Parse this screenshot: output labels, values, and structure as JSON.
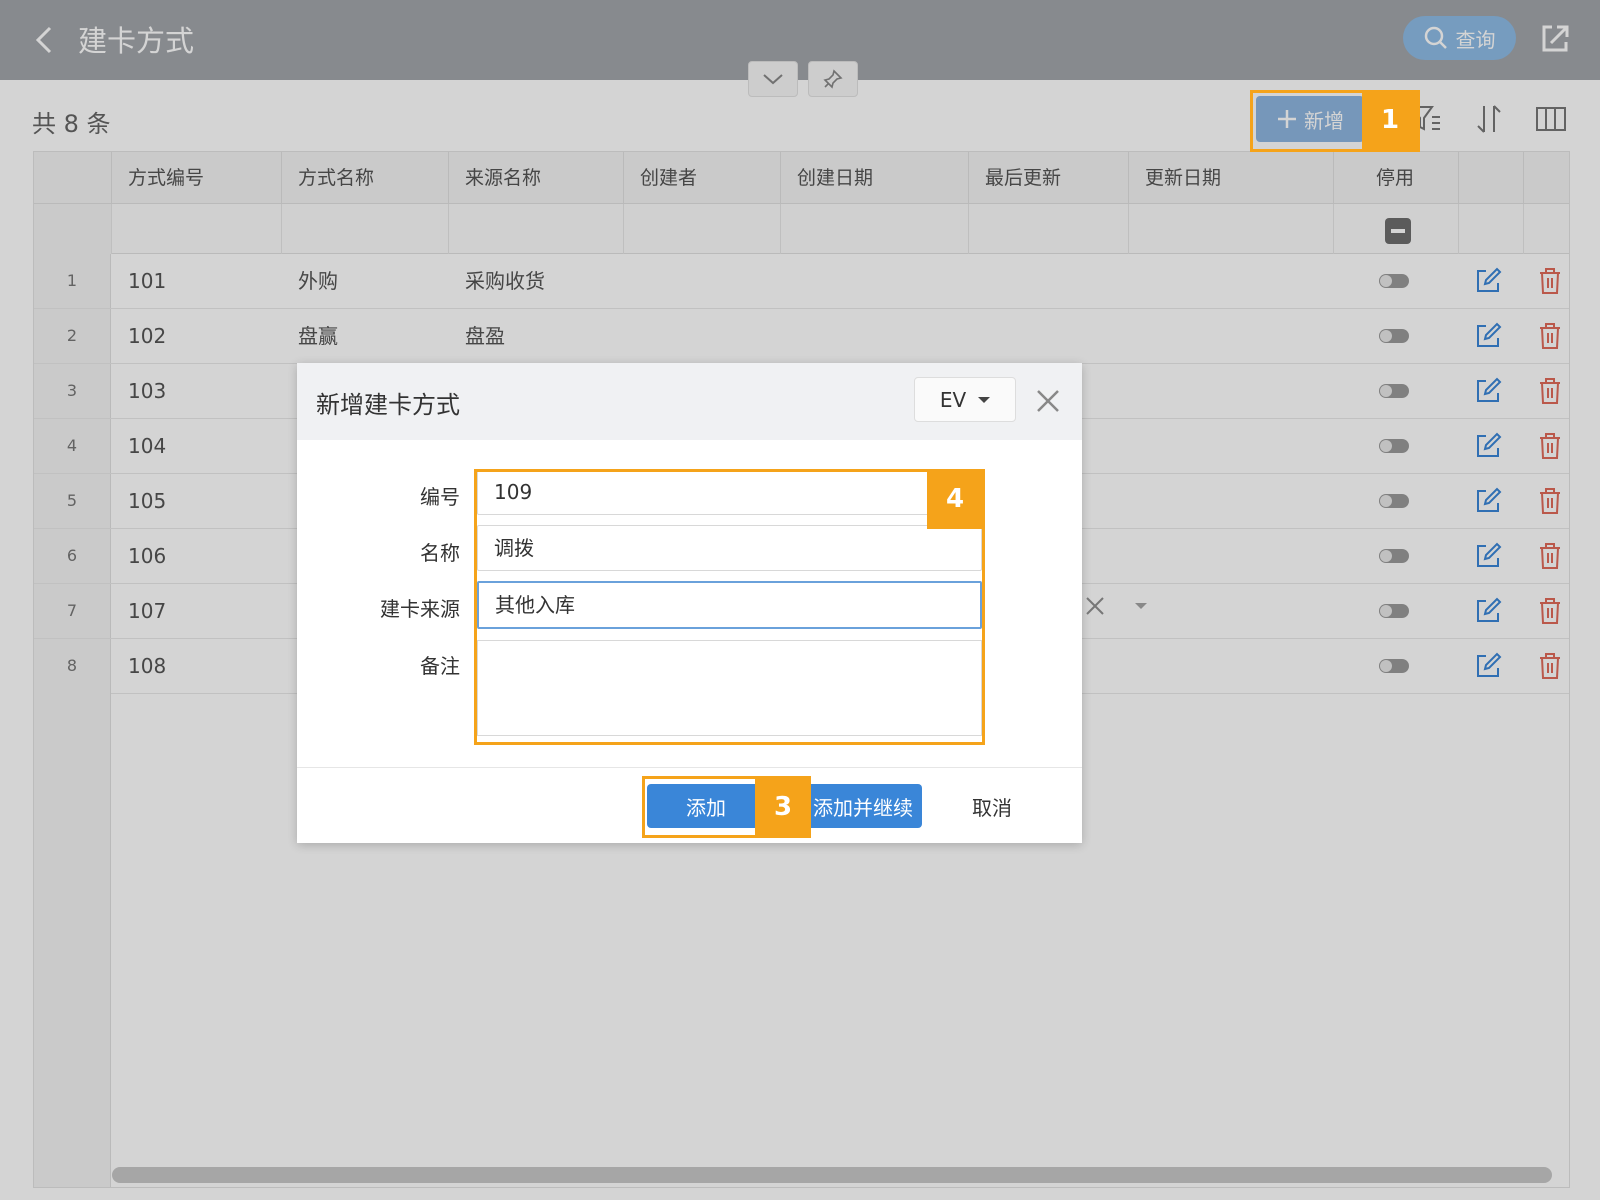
{
  "header": {
    "title": "建卡方式",
    "query_label": "查询"
  },
  "toolbar": {
    "count_text": "共 8 条",
    "add_label": "新增"
  },
  "table": {
    "columns": [
      "方式编号",
      "方式名称",
      "来源名称",
      "创建者",
      "创建日期",
      "最后更新",
      "更新日期",
      "停用"
    ],
    "rows": [
      {
        "index": "1",
        "code": "101",
        "name": "外购",
        "source": "采购收货"
      },
      {
        "index": "2",
        "code": "102",
        "name": "盘赢",
        "source": "盘盈"
      },
      {
        "index": "3",
        "code": "103",
        "name": "",
        "source": ""
      },
      {
        "index": "4",
        "code": "104",
        "name": "",
        "source": ""
      },
      {
        "index": "5",
        "code": "105",
        "name": "",
        "source": ""
      },
      {
        "index": "6",
        "code": "106",
        "name": "",
        "source": ""
      },
      {
        "index": "7",
        "code": "107",
        "name": "",
        "source": ""
      },
      {
        "index": "8",
        "code": "108",
        "name": "",
        "source": ""
      }
    ]
  },
  "modal": {
    "title": "新增建卡方式",
    "lang": "EV",
    "fields": {
      "code_label": "编号",
      "code_value": "109",
      "name_label": "名称",
      "name_value": "调拨",
      "source_label": "建卡来源",
      "source_value": "其他入库",
      "note_label": "备注",
      "note_value": ""
    },
    "buttons": {
      "add": "添加",
      "add_continue": "添加并继续",
      "cancel": "取消"
    }
  },
  "annotations": {
    "badge_1": "1",
    "badge_3": "3",
    "badge_4": "4"
  },
  "colors": {
    "accent": "#3a86d8",
    "highlight": "#f5a31a",
    "topbar": "#a3a6ab",
    "delete": "#e06a5a"
  }
}
